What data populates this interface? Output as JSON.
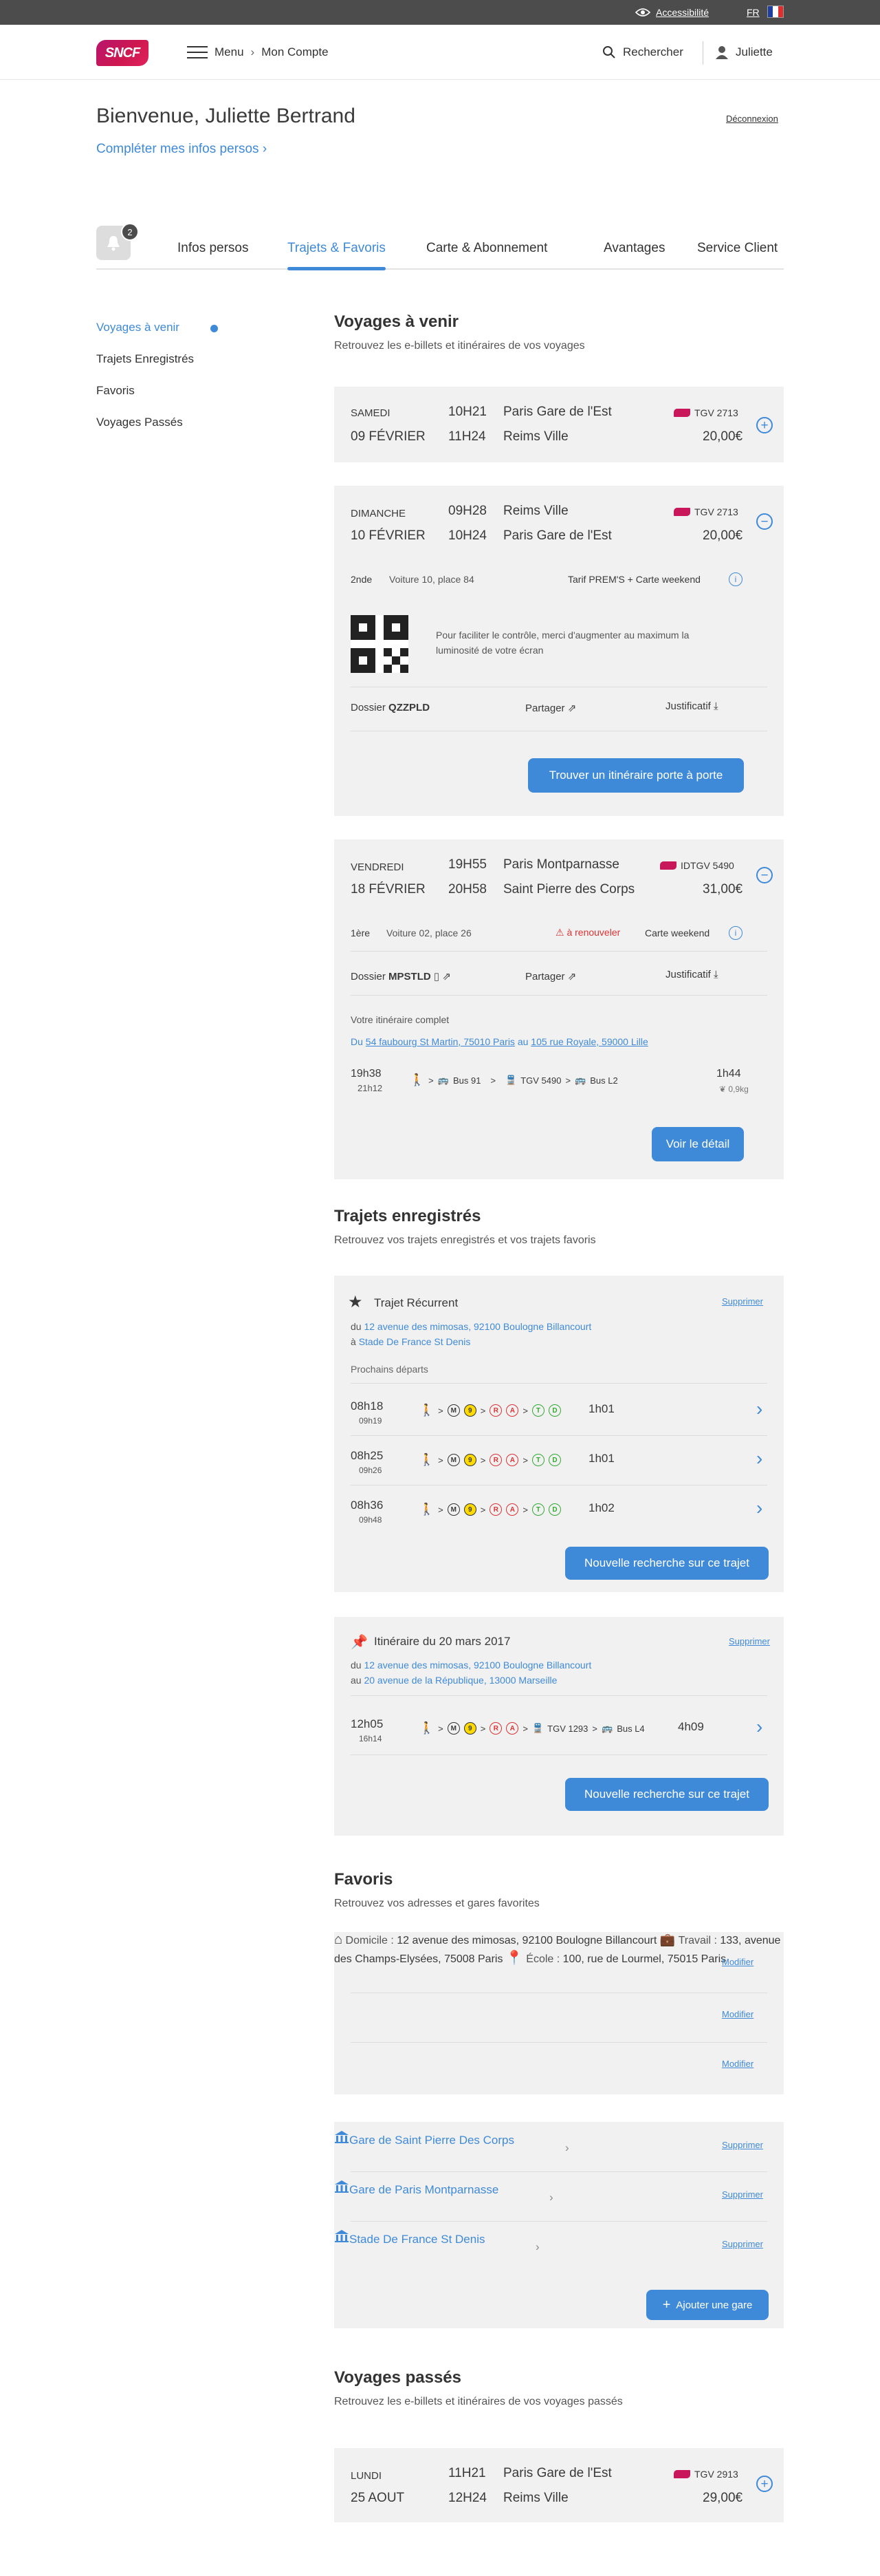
{
  "util": {
    "accessibility": "Accessibilité",
    "lang": "FR"
  },
  "header": {
    "logo": "SNCF",
    "menu": "Menu",
    "breadcrumb": "Mon Compte",
    "search": "Rechercher",
    "user": "Juliette"
  },
  "welcome": {
    "title": "Bienvenue, Juliette Bertrand",
    "logout": "Déconnexion",
    "complete": "Compléter mes infos persos"
  },
  "tabs": {
    "badge": "2",
    "items": [
      "Infos persos",
      "Trajets & Favoris",
      "Carte & Abonnement",
      "Avantages",
      "Service Client"
    ]
  },
  "sidebar": [
    "Voyages à venir",
    "Trajets Enregistrés",
    "Favoris",
    "Voyages Passés"
  ],
  "upcoming": {
    "title": "Voyages à venir",
    "subtitle": "Retrouvez les e-billets et itinéraires de vos voyages",
    "trip1": {
      "day": "SAMEDI",
      "date": "09 FÉVRIER",
      "dep_time": "10H21",
      "arr_time": "11H24",
      "dep": "Paris Gare de l'Est",
      "arr": "Reims Ville",
      "train": "TGV 2713",
      "price": "20,00€"
    },
    "trip2": {
      "day": "DIMANCHE",
      "date": "10 FÉVRIER",
      "dep_time": "09H28",
      "arr_time": "10H24",
      "dep": "Reims Ville",
      "arr": "Paris Gare de l'Est",
      "train": "TGV 2713",
      "price": "20,00€",
      "class": "2nde",
      "seat": "Voiture 10, place 84",
      "fare": "Tarif PREM'S + Carte weekend",
      "qr_text": "Pour faciliter le contrôle, merci d'augmenter au maximum la luminosité de votre écran",
      "dossier_label": "Dossier",
      "dossier": "QZZPLD",
      "share": "Partager",
      "receipt": "Justificatif",
      "cta": "Trouver un itinéraire porte à porte"
    },
    "trip3": {
      "day": "VENDREDI",
      "date": "18 FÉVRIER",
      "dep_time": "19H55",
      "arr_time": "20H58",
      "dep": "Paris Montparnasse",
      "arr": "Saint Pierre des Corps",
      "train": "IDTGV 5490",
      "price": "31,00€",
      "class": "1ère",
      "seat": "Voiture 02, place 26",
      "renew": "à renouveler",
      "card": "Carte weekend",
      "dossier_label": "Dossier",
      "dossier": "MPSTLD",
      "share": "Partager",
      "receipt": "Justificatif",
      "itin_label": "Votre itinéraire complet",
      "from_pre": "Du",
      "from": "54 faubourg St Martin, 75010 Paris",
      "to_pre": "au",
      "to": "105 rue Royale, 59000 Lille",
      "start": "19h38",
      "end": "21h12",
      "bus1": "Bus 91",
      "tgv": "TGV 5490",
      "bus2": "Bus L2",
      "duration": "1h44",
      "co2": "0,9kg",
      "cta": "Voir le détail"
    }
  },
  "saved": {
    "title": "Trajets enregistrés",
    "subtitle": "Retrouvez vos trajets enregistrés et vos trajets favoris",
    "recurring": {
      "title": "Trajet Récurrent",
      "delete": "Supprimer",
      "from_pre": "du",
      "from": "12 avenue des mimosas, 92100 Boulogne Billancourt",
      "to_pre": "à",
      "to": "Stade De France St Denis",
      "next": "Prochains départs",
      "rows": [
        {
          "dep": "08h18",
          "arr": "09h19",
          "dur": "1h01"
        },
        {
          "dep": "08h25",
          "arr": "09h26",
          "dur": "1h01"
        },
        {
          "dep": "08h36",
          "arr": "09h48",
          "dur": "1h02"
        }
      ],
      "cta": "Nouvelle recherche sur ce trajet"
    },
    "itin": {
      "title": "Itinéraire du 20 mars 2017",
      "delete": "Supprimer",
      "from_pre": "du",
      "from": "12 avenue des mimosas, 92100 Boulogne Billancourt",
      "to_pre": "au",
      "to": "20 avenue de la République, 13000 Marseille",
      "dep": "12h05",
      "arr": "16h14",
      "tgv": "TGV 1293",
      "bus": "Bus L4",
      "dur": "4h09",
      "cta": "Nouvelle recherche sur ce trajet"
    }
  },
  "favorites": {
    "title": "Favoris",
    "subtitle": "Retrouvez vos adresses et gares favorites",
    "addresses": [
      {
        "label": "Domicile :",
        "value": "12 avenue des mimosas, 92100 Boulogne Billancourt",
        "edit": "Modifier"
      },
      {
        "label": "Travail :",
        "value": "133, avenue des Champs-Elysées, 75008 Paris",
        "edit": "Modifier"
      },
      {
        "label": "École :",
        "value": "100, rue de Lourmel, 75015 Paris",
        "edit": "Modifier"
      }
    ],
    "stations": [
      {
        "name": "Gare de Saint Pierre Des Corps",
        "delete": "Supprimer"
      },
      {
        "name": "Gare de Paris Montparnasse",
        "delete": "Supprimer"
      },
      {
        "name": "Stade De France St Denis",
        "delete": "Supprimer"
      }
    ],
    "add": "Ajouter une gare"
  },
  "past": {
    "title": "Voyages passés",
    "subtitle": "Retrouvez les e-billets et itinéraires de vos voyages passés",
    "trip": {
      "day": "LUNDI",
      "date": "25 AOUT",
      "dep_time": "11H21",
      "arr_time": "12H24",
      "dep": "Paris Gare de l'Est",
      "arr": "Reims Ville",
      "train": "TGV 2913",
      "price": "29,00€"
    }
  },
  "colors": {
    "accent": "#3f8ad8",
    "brand": "#c8175a",
    "topbar": "#4c4c4c",
    "card": "#f1f1f1"
  }
}
